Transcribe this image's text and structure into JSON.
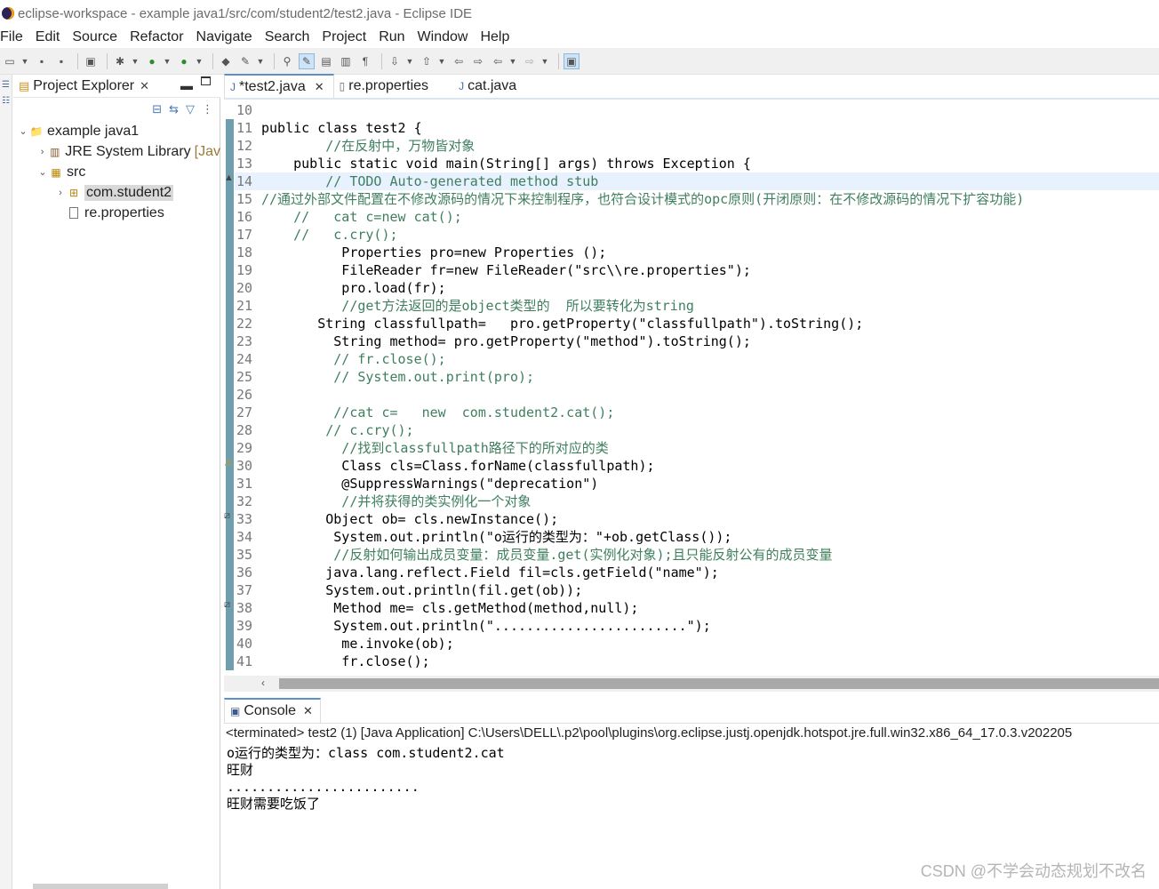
{
  "window": {
    "title": "eclipse-workspace - example java1/src/com/student2/test2.java - Eclipse IDE"
  },
  "menu": [
    "File",
    "Edit",
    "Source",
    "Refactor",
    "Navigate",
    "Search",
    "Project",
    "Run",
    "Window",
    "Help"
  ],
  "explorer": {
    "tab_label": "Project Explorer",
    "tree": {
      "project": "example java1",
      "jre": "JRE System Library",
      "jre_extra": "[Jav",
      "src": "src",
      "package": "com.student2",
      "file": "re.properties"
    }
  },
  "editor": {
    "tabs": [
      "*test2.java",
      "re.properties",
      "cat.java"
    ],
    "lines": [
      {
        "n": "10",
        "text": ""
      },
      {
        "n": "11",
        "text": "public class test2 {"
      },
      {
        "n": "12",
        "text": "        //在反射中，万物皆对象"
      },
      {
        "n": "13",
        "text": "    public static void main(String[] args) throws Exception {"
      },
      {
        "n": "14",
        "text": "        // TODO Auto-generated method stub"
      },
      {
        "n": "15",
        "text": "//通过外部文件配置在不修改源码的情况下来控制程序，也符合设计模式的opc原则(开闭原则：在不修改源码的情况下扩容功能)"
      },
      {
        "n": "16",
        "text": "    //   cat c=new cat();"
      },
      {
        "n": "17",
        "text": "    //   c.cry();"
      },
      {
        "n": "18",
        "text": "          Properties pro=new Properties ();"
      },
      {
        "n": "19",
        "text": "          FileReader fr=new FileReader(\"src\\\\re.properties\");"
      },
      {
        "n": "20",
        "text": "          pro.load(fr);"
      },
      {
        "n": "21",
        "text": "          //get方法返回的是object类型的  所以要转化为string"
      },
      {
        "n": "22",
        "text": "       String classfullpath=   pro.getProperty(\"classfullpath\").toString();"
      },
      {
        "n": "23",
        "text": "         String method= pro.getProperty(\"method\").toString();"
      },
      {
        "n": "24",
        "text": "         // fr.close();"
      },
      {
        "n": "25",
        "text": "         // System.out.print(pro);"
      },
      {
        "n": "26",
        "text": ""
      },
      {
        "n": "27",
        "text": "         //cat c=   new  com.student2.cat();"
      },
      {
        "n": "28",
        "text": "        // c.cry();"
      },
      {
        "n": "29",
        "text": "          //找到classfullpath路径下的所对应的类"
      },
      {
        "n": "30",
        "text": "          Class cls=Class.forName(classfullpath);"
      },
      {
        "n": "31",
        "text": "          @SuppressWarnings(\"deprecation\")"
      },
      {
        "n": "32",
        "text": "          //并将获得的类实例化一个对象"
      },
      {
        "n": "33",
        "text": "        Object ob= cls.newInstance();"
      },
      {
        "n": "34",
        "text": "         System.out.println(\"o运行的类型为：\"+ob.getClass());"
      },
      {
        "n": "35",
        "text": "         //反射如何输出成员变量：成员变量.get(实例化对象);且只能反射公有的成员变量"
      },
      {
        "n": "36",
        "text": "        java.lang.reflect.Field fil=cls.getField(\"name\");"
      },
      {
        "n": "37",
        "text": "        System.out.println(fil.get(ob));"
      },
      {
        "n": "38",
        "text": "         Method me= cls.getMethod(method,null);"
      },
      {
        "n": "39",
        "text": "         System.out.println(\"........................\");"
      },
      {
        "n": "40",
        "text": "          me.invoke(ob);"
      },
      {
        "n": "41",
        "text": "          fr.close();"
      }
    ]
  },
  "console": {
    "tab_label": "Console",
    "status": "<terminated> test2 (1) [Java Application] C:\\Users\\DELL\\.p2\\pool\\plugins\\org.eclipse.justj.openjdk.hotspot.jre.full.win32.x86_64_17.0.3.v202205",
    "output": [
      "o运行的类型为：class com.student2.cat",
      "旺财",
      "........................",
      "旺财需要吃饭了"
    ]
  },
  "watermark": "CSDN @不学会动态规划不改名"
}
